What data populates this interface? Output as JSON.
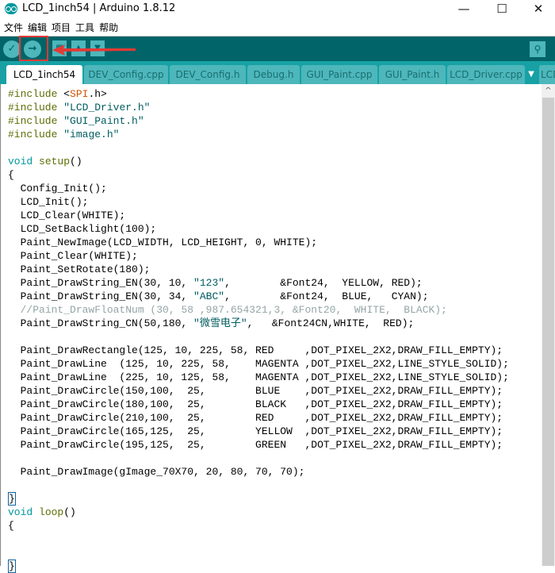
{
  "window": {
    "title": "LCD_1inch54 | Arduino 1.8.12",
    "minimize": "—",
    "maximize": "☐",
    "close": "✕"
  },
  "menu": [
    "文件",
    "编辑",
    "项目",
    "工具",
    "帮助"
  ],
  "toolbar": {
    "verify": "✓",
    "upload": "→",
    "new": "▦",
    "open": "▲",
    "save": "▼",
    "serial_monitor": "⚲",
    "highlight_color": "#e53935"
  },
  "tabs": [
    "LCD_1inch54",
    "DEV_Config.cpp",
    "DEV_Config.h",
    "Debug.h",
    "GUI_Paint.cpp",
    "GUI_Paint.h",
    "LCD_Driver.cpp",
    "LCD"
  ],
  "tab_menu": "▼",
  "active_tab": 0,
  "colors": {
    "toolbar": "#006468",
    "tabbar": "#17A1A5",
    "tab": "#4DB7BB",
    "keyword": "#5E6D03",
    "type": "#00979C",
    "string": "#005C5F",
    "library": "#D35400",
    "comment": "#95A5A6"
  },
  "code": {
    "lines": [
      "#include <SPI.h>",
      "#include \"LCD_Driver.h\"",
      "#include \"GUI_Paint.h\"",
      "#include \"image.h\"",
      "",
      "void setup()",
      "{",
      "  Config_Init();",
      "  LCD_Init();",
      "  LCD_Clear(WHITE);",
      "  LCD_SetBacklight(100);",
      "  Paint_NewImage(LCD_WIDTH, LCD_HEIGHT, 0, WHITE);",
      "  Paint_Clear(WHITE);",
      "  Paint_SetRotate(180);",
      "  Paint_DrawString_EN(30, 10, \"123\",        &Font24,  YELLOW, RED);",
      "  Paint_DrawString_EN(30, 34, \"ABC\",        &Font24,  BLUE,   CYAN);",
      "  //Paint_DrawFloatNum (30, 58 ,987.654321,3, &Font20,  WHITE,  BLACK);",
      "  Paint_DrawString_CN(50,180, \"微雪电子\",   &Font24CN,WHITE,  RED);",
      "",
      "  Paint_DrawRectangle(125, 10, 225, 58, RED     ,DOT_PIXEL_2X2,DRAW_FILL_EMPTY);",
      "  Paint_DrawLine  (125, 10, 225, 58,    MAGENTA ,DOT_PIXEL_2X2,LINE_STYLE_SOLID);",
      "  Paint_DrawLine  (225, 10, 125, 58,    MAGENTA ,DOT_PIXEL_2X2,LINE_STYLE_SOLID);",
      "  Paint_DrawCircle(150,100,  25,        BLUE    ,DOT_PIXEL_2X2,DRAW_FILL_EMPTY);",
      "  Paint_DrawCircle(180,100,  25,        BLACK   ,DOT_PIXEL_2X2,DRAW_FILL_EMPTY);",
      "  Paint_DrawCircle(210,100,  25,        RED     ,DOT_PIXEL_2X2,DRAW_FILL_EMPTY);",
      "  Paint_DrawCircle(165,125,  25,        YELLOW  ,DOT_PIXEL_2X2,DRAW_FILL_EMPTY);",
      "  Paint_DrawCircle(195,125,  25,        GREEN   ,DOT_PIXEL_2X2,DRAW_FILL_EMPTY);",
      "",
      "  Paint_DrawImage(gImage_70X70, 20, 80, 70, 70);",
      "",
      "}",
      "void loop()",
      "{",
      "",
      "",
      "}"
    ]
  },
  "scrollbar": {
    "up": "^"
  }
}
